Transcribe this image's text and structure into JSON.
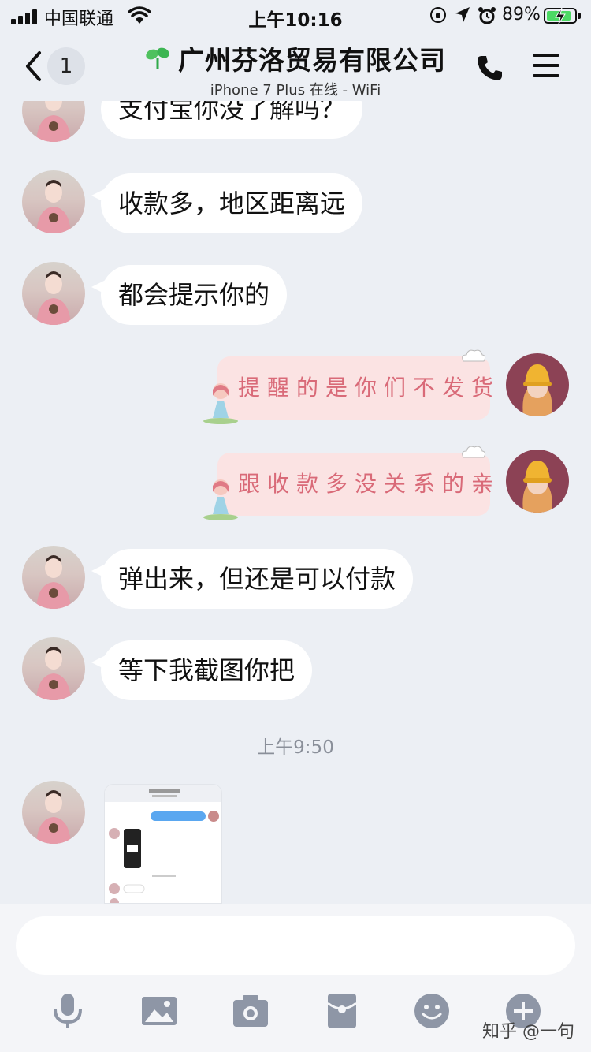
{
  "status_bar": {
    "carrier": "中国联通",
    "time": "上午10:16",
    "battery_percent": "89%",
    "battery_level": 0.89
  },
  "header": {
    "back_count": "1",
    "title": "广州芬洛贸易有限公司",
    "subtitle": "iPhone 7 Plus 在线 - WiFi",
    "icons": [
      "back-chevron-icon",
      "sprout-icon",
      "phone-icon",
      "menu-icon"
    ]
  },
  "messages": [
    {
      "side": "left",
      "text": "支付宝你没了解吗？"
    },
    {
      "side": "left",
      "text": "收款多，地区距离远"
    },
    {
      "side": "left",
      "text": "都会提示你的"
    },
    {
      "side": "right",
      "text": "提醒的是你们不发货"
    },
    {
      "side": "right",
      "text": "跟收款多没关系的亲"
    },
    {
      "side": "left",
      "text": "弹出来，但还是可以付款"
    },
    {
      "side": "left",
      "text": "等下我截图你把"
    }
  ],
  "time_divider": "上午9:50",
  "input": {
    "placeholder": ""
  },
  "toolbar": [
    "microphone-icon",
    "image-icon",
    "camera-icon",
    "red-packet-icon",
    "emoji-icon",
    "plus-icon"
  ],
  "watermark": "知乎 @一句",
  "colors": {
    "background": "#eceff4",
    "bubble_left": "#ffffff",
    "bubble_right": "#fbe3e3",
    "right_text": "#d96a78",
    "icon_gray": "#8e96a6"
  }
}
